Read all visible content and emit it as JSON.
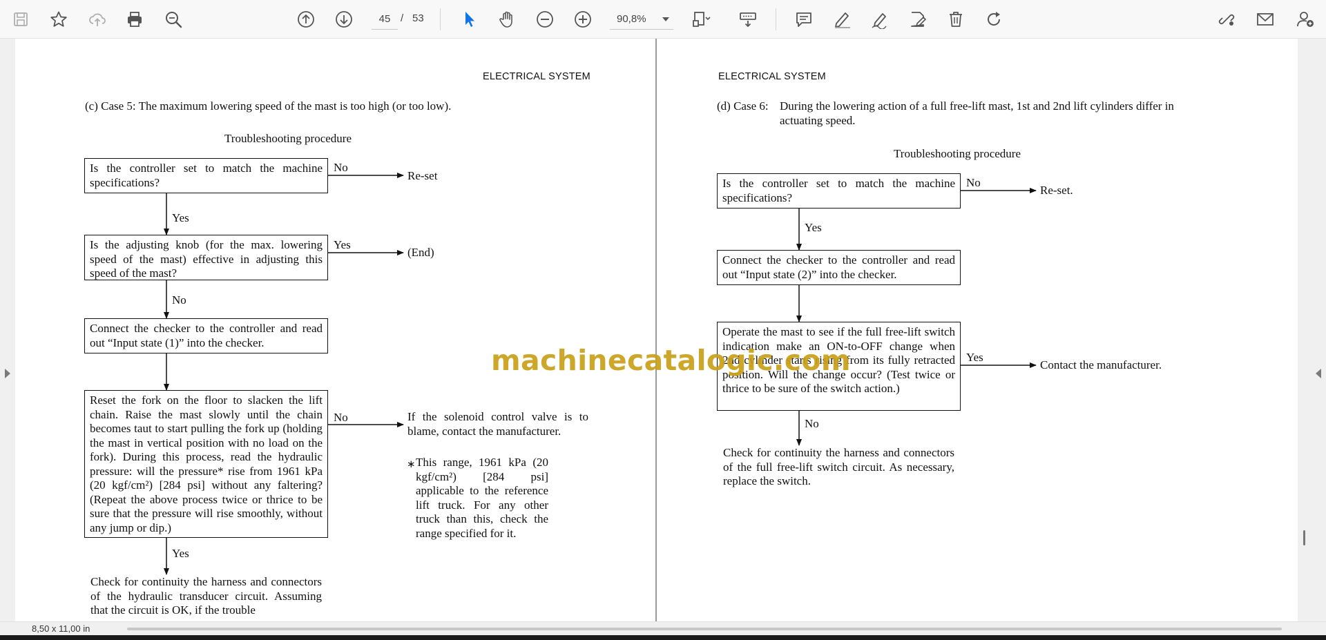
{
  "toolbar": {
    "page_current": "45",
    "page_separator": "/",
    "page_total": "53",
    "zoom": "90,8%",
    "colors": {
      "active_tool": "#1473e6",
      "icon": "#555555"
    }
  },
  "statusbar": {
    "page_size": "8,50 x 11,00 in"
  },
  "watermark": "machinecatalogic.com",
  "left_page": {
    "header": "ELECTRICAL SYSTEM",
    "case": "(c)  Case 5: The maximum lowering speed of the mast is too high (or too low).",
    "procedure_title": "Troubleshooting procedure",
    "box1": "Is the controller set to match the machine specifications?",
    "box1_no": "No",
    "box1_result": "Re-set",
    "box1_yes": "Yes",
    "box2": "Is the adjusting knob (for the max. lowering speed of the mast) effective in adjusting this speed of the mast?",
    "box2_yes": "Yes",
    "box2_result": "(End)",
    "box2_no": "No",
    "box3": "Connect the checker to the controller and read out “Input state (1)” into the checker.",
    "box4": "Reset the fork on the floor to slacken the lift chain. Raise the mast slowly until the chain becomes taut to start pulling the fork up (holding the mast in vertical position with no load on the fork). During this process, read the hydraulic pressure: will the pressure* rise from 1961 kPa (20 kgf/cm²) [284 psi] without any faltering? (Repeat the above process twice or thrice to be sure that the pressure will rise smoothly, without any jump or dip.)",
    "box4_no": "No",
    "box4_result": "If the solenoid control valve is to blame, contact the manufacturer.",
    "note_marker": "∗",
    "note": "This range, 1961 kPa (20 kgf/cm²) [284 psi] applicable to the reference lift truck. For any other truck than this, check the range specified for it.",
    "box4_yes": "Yes",
    "final": "Check for continuity the harness and connectors of the hydraulic transducer circuit. Assuming that the circuit is OK, if the trouble"
  },
  "right_page": {
    "header": "ELECTRICAL SYSTEM",
    "case_label": "(d)  Case 6:",
    "case_text": "During the lowering action of a full free-lift mast, 1st and 2nd lift cylinders differ in actuating speed.",
    "procedure_title": "Troubleshooting procedure",
    "box1": "Is the controller set to match the machine specifications?",
    "box1_no": "No",
    "box1_result": "Re-set.",
    "box1_yes": "Yes",
    "box2": "Connect the checker to the controller and read out “Input state (2)” into the checker.",
    "box3": "Operate the mast to see if the full free-lift switch indication make an ON-to-OFF change when 2nd cylinder starts rising from its fully retracted position. Will the change occur? (Test twice or thrice to be sure of the switch action.)",
    "box3_yes": "Yes",
    "box3_result": "Contact the manufacturer.",
    "box3_no": "No",
    "final": "Check for continuity the harness and connectors of the full free-lift switch circuit. As necessary, replace the switch."
  }
}
